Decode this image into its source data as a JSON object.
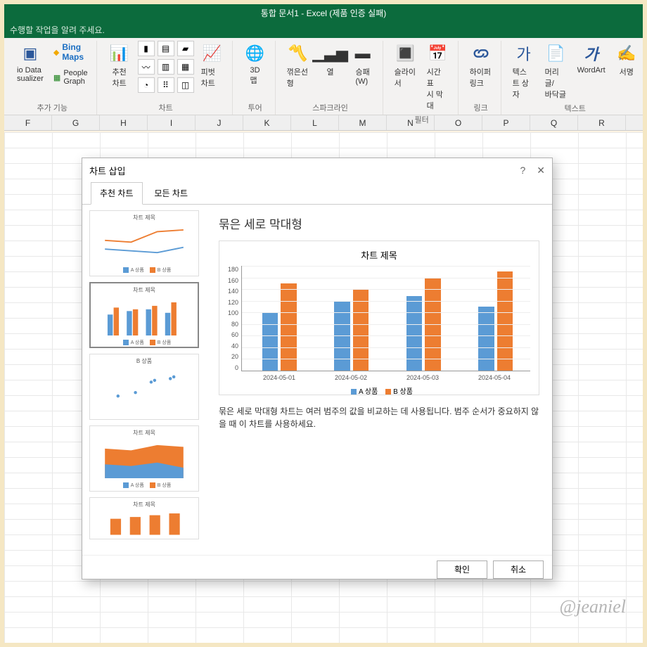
{
  "title": "통합 문서1 - Excel (제품 인증 실패)",
  "tell_me": "수행할 작업을 알려 주세요.",
  "ribbon": {
    "addins_group": "추가 기능",
    "bing_maps": "Bing Maps",
    "visio_data": "io Data\nsualizer",
    "people_graph": "People Graph",
    "charts_group": "차트",
    "recommended_charts": "추천\n차트",
    "pivot_chart": "피벗 차트",
    "tours_group": "투어",
    "threeD_map": "3D\n맵",
    "sparklines_group": "스파크라인",
    "line_spark": "꺾은선형",
    "column_spark": "열",
    "winloss_spark": "승패\n(W)",
    "filters_group": "필터",
    "slicer": "슬라이서",
    "timeline": "시간 표\n시 막대",
    "links_group": "링크",
    "hyperlink": "하이퍼링크",
    "text_group": "텍스트",
    "textbox": "텍스\n트 상자",
    "headerfooter": "머리글/\n바닥글",
    "wordart": "WordArt",
    "sigline": "서명"
  },
  "columns": [
    "F",
    "G",
    "H",
    "I",
    "J",
    "K",
    "L",
    "M",
    "N",
    "O",
    "P",
    "Q",
    "R"
  ],
  "dialog": {
    "title": "차트 삽입",
    "help": "?",
    "close": "✕",
    "tab_recommended": "추천 차트",
    "tab_all": "모든 차트",
    "chart_type_title": "묶은 세로 막대형",
    "preview_title": "차트 제목",
    "description": "묶은 세로 막대형 차트는 여러 범주의 값을 비교하는 데 사용됩니다. 범주 순서가 중요하지 않을 때 이 차트를 사용하세요.",
    "ok": "확인",
    "cancel": "취소",
    "thumb_title": "차트 제목",
    "thumb_scatter_title": "B 상품",
    "legendA": "A 상품",
    "legendB": "B 상품"
  },
  "chart_data": {
    "type": "bar",
    "title": "차트 제목",
    "categories": [
      "2024-05-01",
      "2024-05-02",
      "2024-05-03",
      "2024-05-04"
    ],
    "series": [
      {
        "name": "A 상품",
        "color": "#5b9bd5",
        "values": [
          100,
          120,
          128,
          110
        ]
      },
      {
        "name": "B 상품",
        "color": "#ed7d31",
        "values": [
          150,
          140,
          160,
          170
        ]
      }
    ],
    "ylabel": "",
    "xlabel": "",
    "ylim": [
      0,
      180
    ],
    "yticks": [
      0,
      20,
      40,
      60,
      80,
      100,
      120,
      140,
      160,
      180
    ]
  },
  "watermark": "@jeaniel"
}
